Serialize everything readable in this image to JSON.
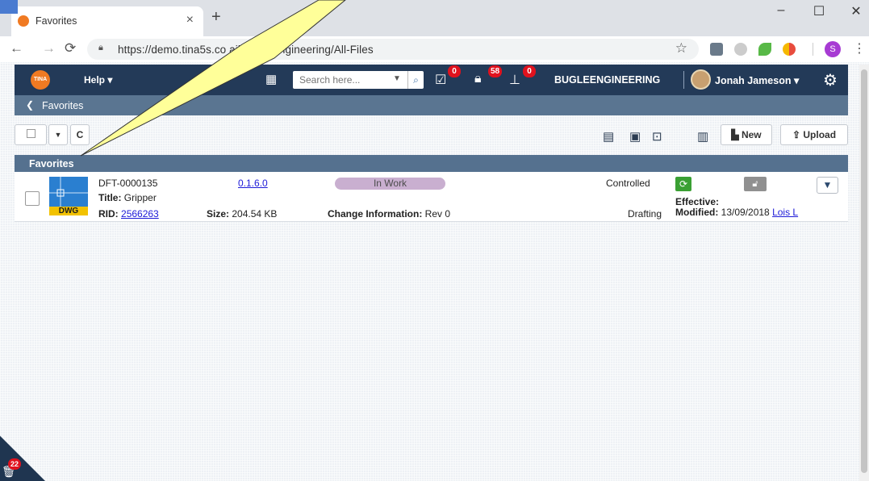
{
  "browser": {
    "tab_title": "Favorites",
    "tab_close": "×",
    "new_tab": "+",
    "url": "https://demo.tina5s.co        ail/BugleEngineering/All-Files",
    "window_controls": {
      "minimize": "–",
      "maximize": "☐",
      "close": "✕"
    },
    "profile_initial": "S"
  },
  "app": {
    "logo_text": "TINA",
    "help_label": "Help ▾",
    "search": {
      "placeholder": "Search here..."
    },
    "badges": {
      "tasks": "0",
      "locks": "58",
      "workflow": "0"
    },
    "organization": "BUGLEENGINEERING",
    "user_name": "Jonah Jameson ▾",
    "breadcrumb": "Favorites"
  },
  "actions": {
    "refresh": "C",
    "new_label": "New",
    "upload_label": "Upload"
  },
  "favorites": {
    "panel_title": "Favorites",
    "rows": [
      {
        "file_type": "DWG",
        "doc_number": "DFT-0000135",
        "title_label": "Title:",
        "title": "Gripper",
        "rid_label": "RID:",
        "rid": "2566263",
        "version": "0.1.6.0",
        "size_label": "Size:",
        "size": "204.54 KB",
        "status": "In Work",
        "change_label": "Change Information:",
        "change": "Rev 0",
        "control": "Controlled",
        "category": "Drafting",
        "effective_label": "Effective:",
        "modified_label": "Modified:",
        "modified_date": "13/09/2018",
        "modified_by": "Lois L"
      }
    ]
  },
  "trash": {
    "count": "22"
  },
  "colors": {
    "header_bg": "#233a58",
    "subbar_bg": "#5a7591",
    "status_pill": "#c9afd0",
    "badge_red": "#e0121e",
    "accent_orange": "#f07a22"
  },
  "icons": [
    "favicon-icon",
    "back-icon",
    "forward-icon",
    "reload-icon",
    "lock-icon",
    "star-icon",
    "apps-grid-icon",
    "search-icon",
    "tasks-icon",
    "lock-badge-icon",
    "workflow-icon",
    "gear-icon",
    "refresh-icon",
    "list-view-icon",
    "folder-icon",
    "favorite-icon",
    "details-icon",
    "file-new-icon",
    "upload-icon",
    "dwg-file-icon",
    "sync-icon",
    "unlock-icon",
    "chevron-down-icon",
    "trash-icon"
  ]
}
